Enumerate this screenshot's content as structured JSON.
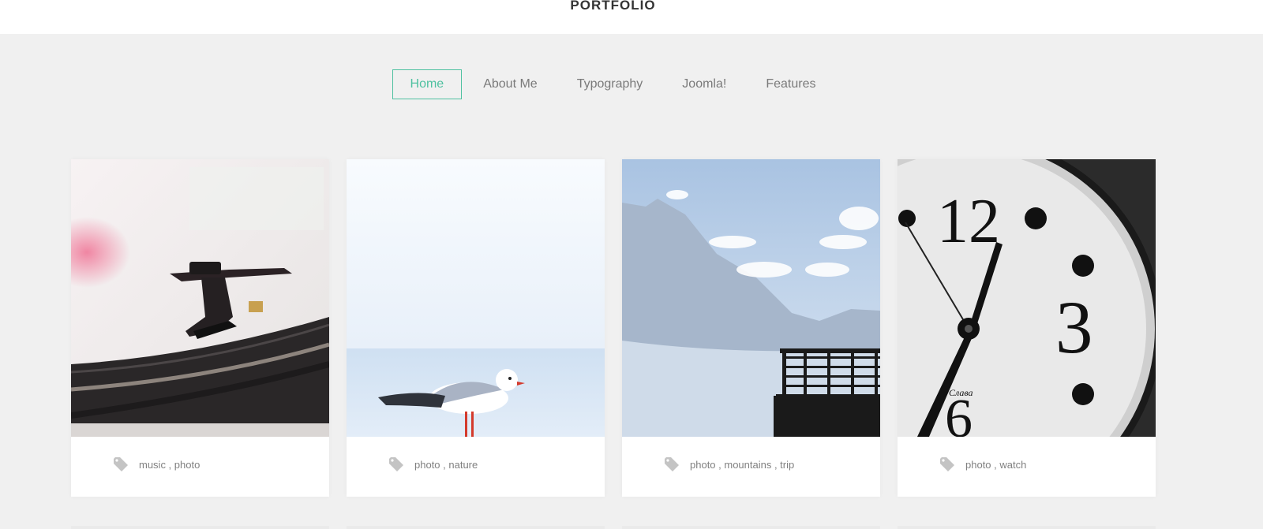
{
  "site": {
    "title": "PORTFOLIO"
  },
  "nav": {
    "items": [
      {
        "label": "Home",
        "active": true
      },
      {
        "label": "About Me"
      },
      {
        "label": "Typography"
      },
      {
        "label": "Joomla!"
      },
      {
        "label": "Features"
      }
    ],
    "accent_color": "#4fc1a0"
  },
  "cards": [
    {
      "tags": "music , photo",
      "image": "turntable-photo",
      "icon": "tag-icon"
    },
    {
      "tags": "photo , nature",
      "image": "seagull-photo",
      "icon": "tag-icon"
    },
    {
      "tags": "photo , mountains , trip",
      "image": "mountain-lake-photo",
      "icon": "tag-icon"
    },
    {
      "tags": "photo , watch",
      "image": "clock-photo",
      "icon": "tag-icon"
    }
  ]
}
